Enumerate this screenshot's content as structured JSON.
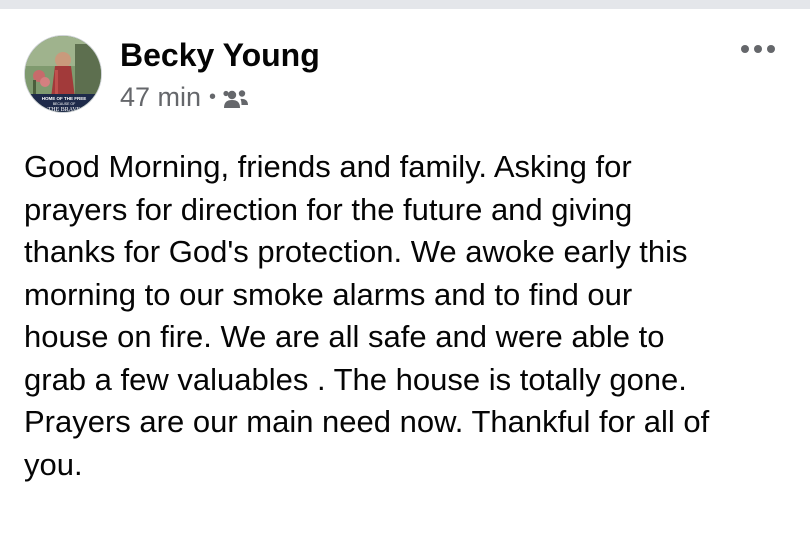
{
  "post": {
    "author_name": "Becky Young",
    "timestamp": "47 min",
    "separator": "•",
    "audience_icon": "friends-icon",
    "more_icon": "more-options-icon",
    "avatar_caption": [
      "HOME OF THE FREE",
      "BECAUSE OF",
      "THE BRAVE"
    ],
    "text": "Good Morning, friends and family. Asking for\nprayers for direction for the future and giving\nthanks for God's protection. We awoke early this\nmorning to our smoke alarms and to find our\nhouse on fire. We are all safe and were able to\ngrab a few valuables . The house is totally gone.\nPrayers are our main need now.  Thankful for all of\nyou."
  },
  "colors": {
    "text_primary": "#050505",
    "text_secondary": "#65676b",
    "divider": "#e4e6ea",
    "background": "#ffffff"
  }
}
